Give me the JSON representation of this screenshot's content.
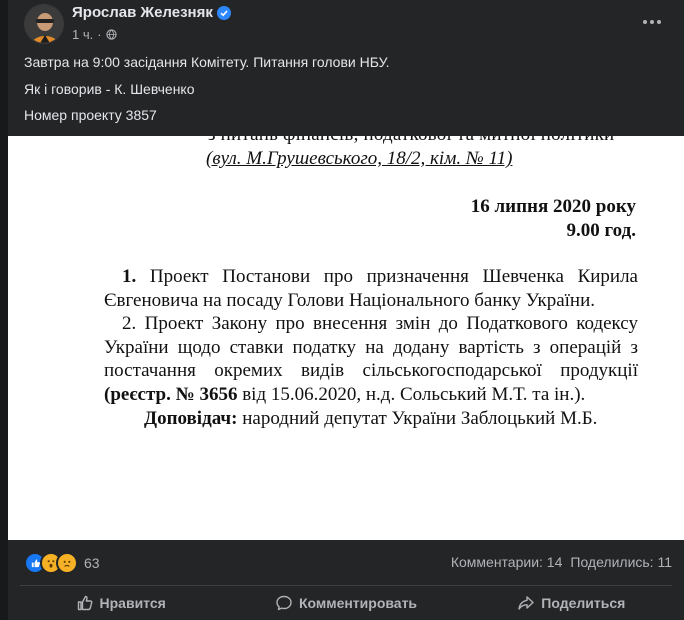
{
  "post": {
    "author": "Ярослав Железняк",
    "time": "1 ч.",
    "text_lines": [
      "Завтра на 9:00 засідання Комітету. Питання голови НБУ.",
      "Як і говорив - К. Шевченко",
      "Номер проекту 3857"
    ]
  },
  "document": {
    "top_line": "з питань фінансів, податкової та митної політики",
    "address": "(вул. М.Грушевського, 18/2, кім. № 11)",
    "date": "16 липня 2020 року",
    "time": "9.00 год.",
    "item1_num": "1.",
    "item1_text": " Проект Постанови про призначення Шевченка Кирила Євгеновича на посаду Голови Національного банку України.",
    "item2_text_a": "2. Проект Закону про внесення змін до Податкового кодексу України щодо ставки податку на додану вартість з операцій з постачання окремих видів сільськогосподарської продукції ",
    "item2_reg": "(реєстр. № 3656",
    "item2_text_b": " від 15.06.2020, н.д. Сольський М.Т. та ін.).",
    "speaker_label": "Доповідач:",
    "speaker_text": " народний депутат України Заблоцький М.Б."
  },
  "reactions": {
    "count": "63",
    "comments": "Комментарии: 14",
    "shares": "Поделились: 11",
    "icons": [
      "like-icon",
      "wow-icon",
      "sad-icon"
    ]
  },
  "actions": {
    "like": "Нравится",
    "comment": "Комментировать",
    "share": "Поделиться"
  },
  "colors": {
    "background": "#242526",
    "text": "#e4e6eb",
    "muted": "#b0b3b8",
    "verified": "#2d88ff"
  }
}
